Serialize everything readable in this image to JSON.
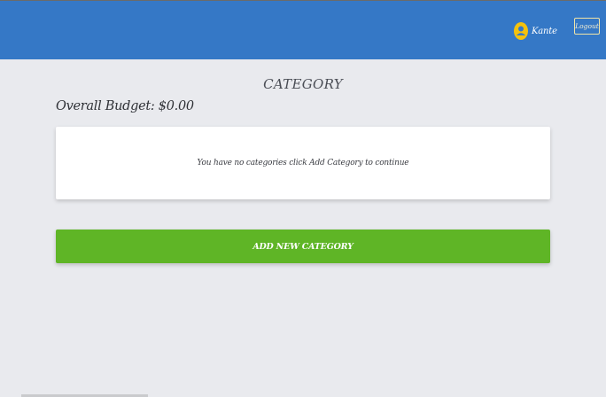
{
  "header": {
    "user_name": "Kante",
    "user_icon": "user-avatar-icon",
    "logout_label": "Logout",
    "colors": {
      "background": "#3578c6",
      "avatar": "#f4c20d"
    }
  },
  "main": {
    "title": "CATEGORY",
    "budget_label": "Overall Budget: ",
    "budget_value": "$0.00",
    "empty_message": "You have no categories click Add Category to continue",
    "add_button_label": "ADD NEW CATEGORY",
    "colors": {
      "add_button": "#5fb526",
      "page_background": "#e9eaee"
    }
  }
}
